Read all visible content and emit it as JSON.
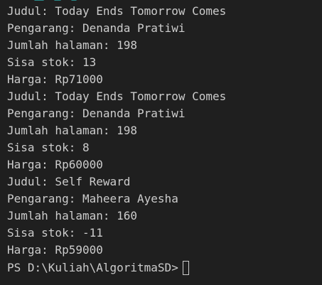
{
  "terminal": {
    "lines": [
      "Judul: Today Ends Tomorrow Comes",
      "Pengarang: Denanda Pratiwi",
      "Jumlah halaman: 198",
      "Sisa stok: 13",
      "Harga: Rp71000",
      "Judul: Today Ends Tomorrow Comes",
      "Pengarang: Denanda Pratiwi",
      "Jumlah halaman: 198",
      "Sisa stok: 8",
      "Harga: Rp60000",
      "Judul: Self Reward",
      "Pengarang: Maheera Ayesha",
      "Jumlah halaman: 160",
      "Sisa stok: -11",
      "Harga: Rp59000"
    ],
    "prompt": "PS D:\\Kuliah\\AlgoritmaSD>",
    "colors": {
      "background": "#1f1f1f",
      "text": "#cccccc"
    }
  }
}
